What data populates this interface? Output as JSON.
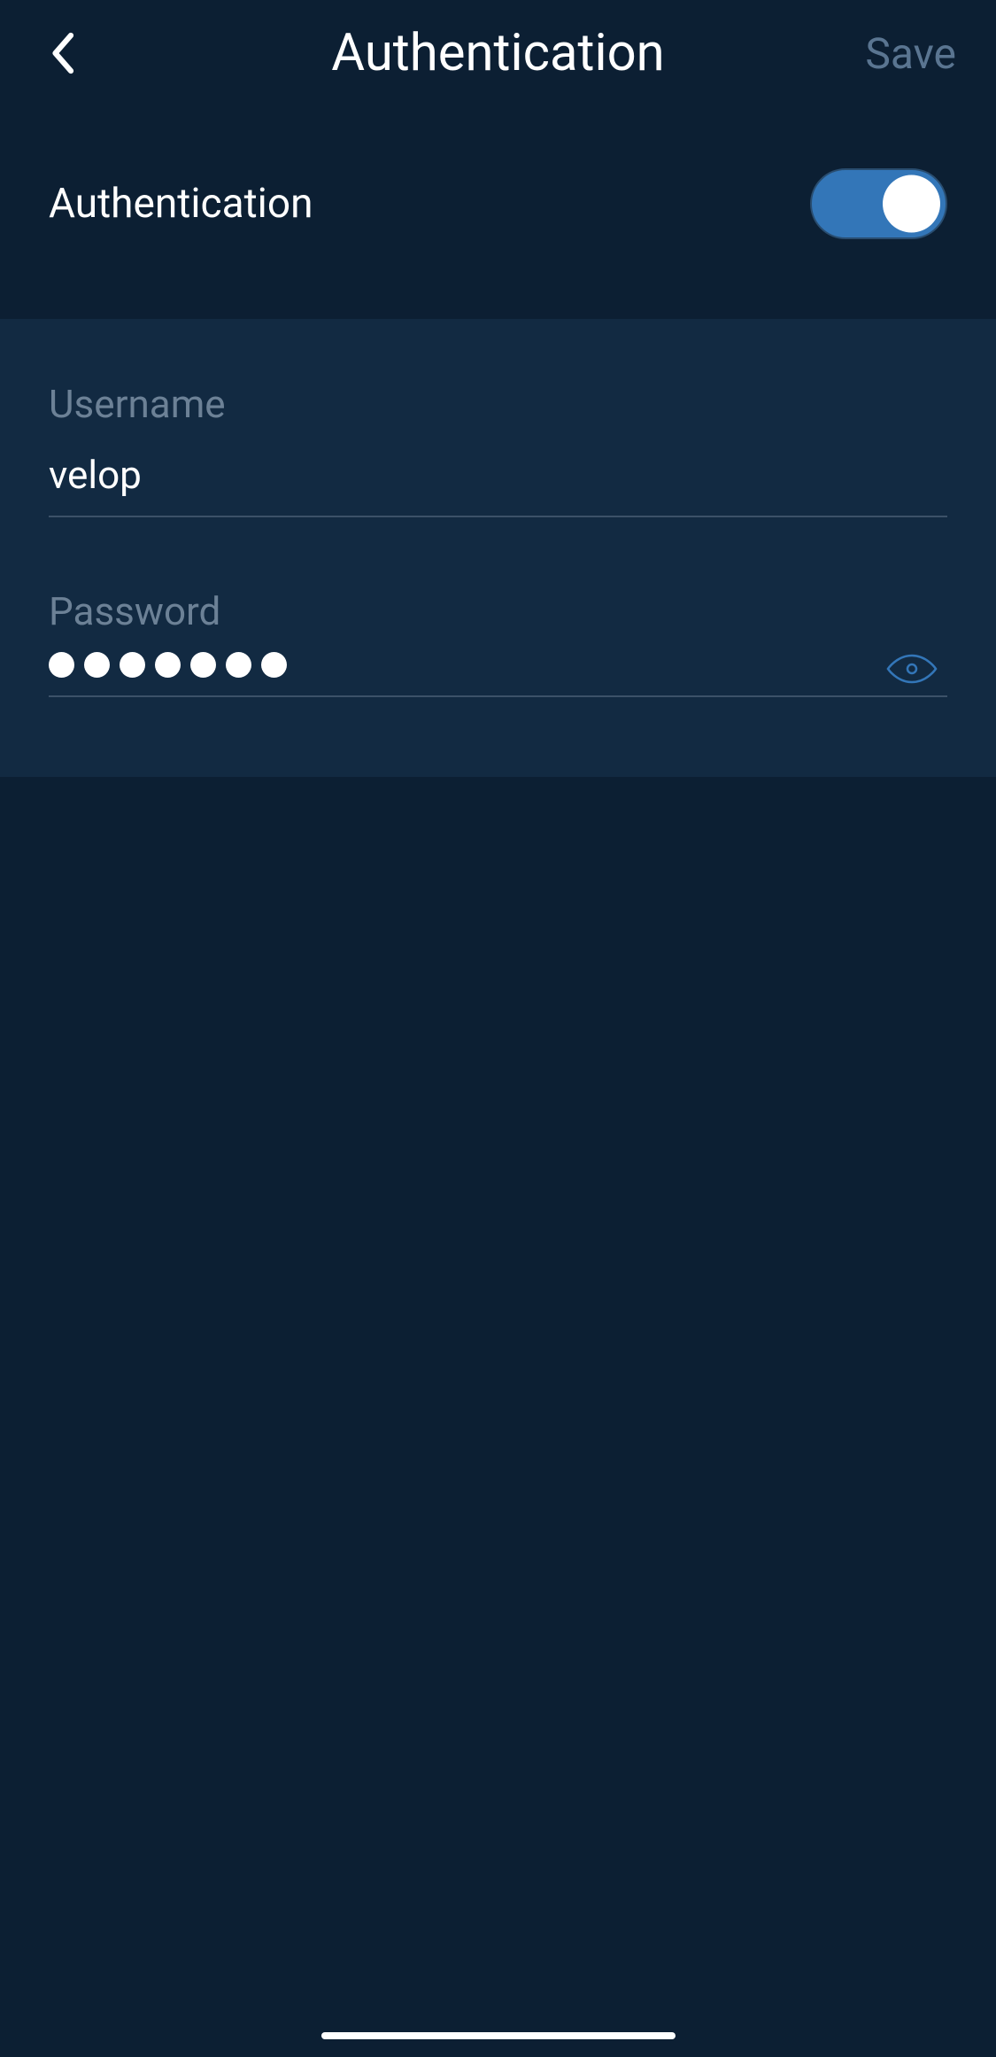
{
  "header": {
    "title": "Authentication",
    "save_label": "Save"
  },
  "auth_toggle": {
    "label": "Authentication",
    "enabled": true
  },
  "form": {
    "username": {
      "label": "Username",
      "value": "velop"
    },
    "password": {
      "label": "Password",
      "dot_count": 7
    }
  },
  "colors": {
    "bg_primary": "#0c1f33",
    "bg_secondary": "#122a42",
    "text_primary": "#ffffff",
    "text_secondary": "#6c8196",
    "text_disabled": "#5a7591",
    "accent": "#3376b8",
    "border": "#3c5168"
  }
}
